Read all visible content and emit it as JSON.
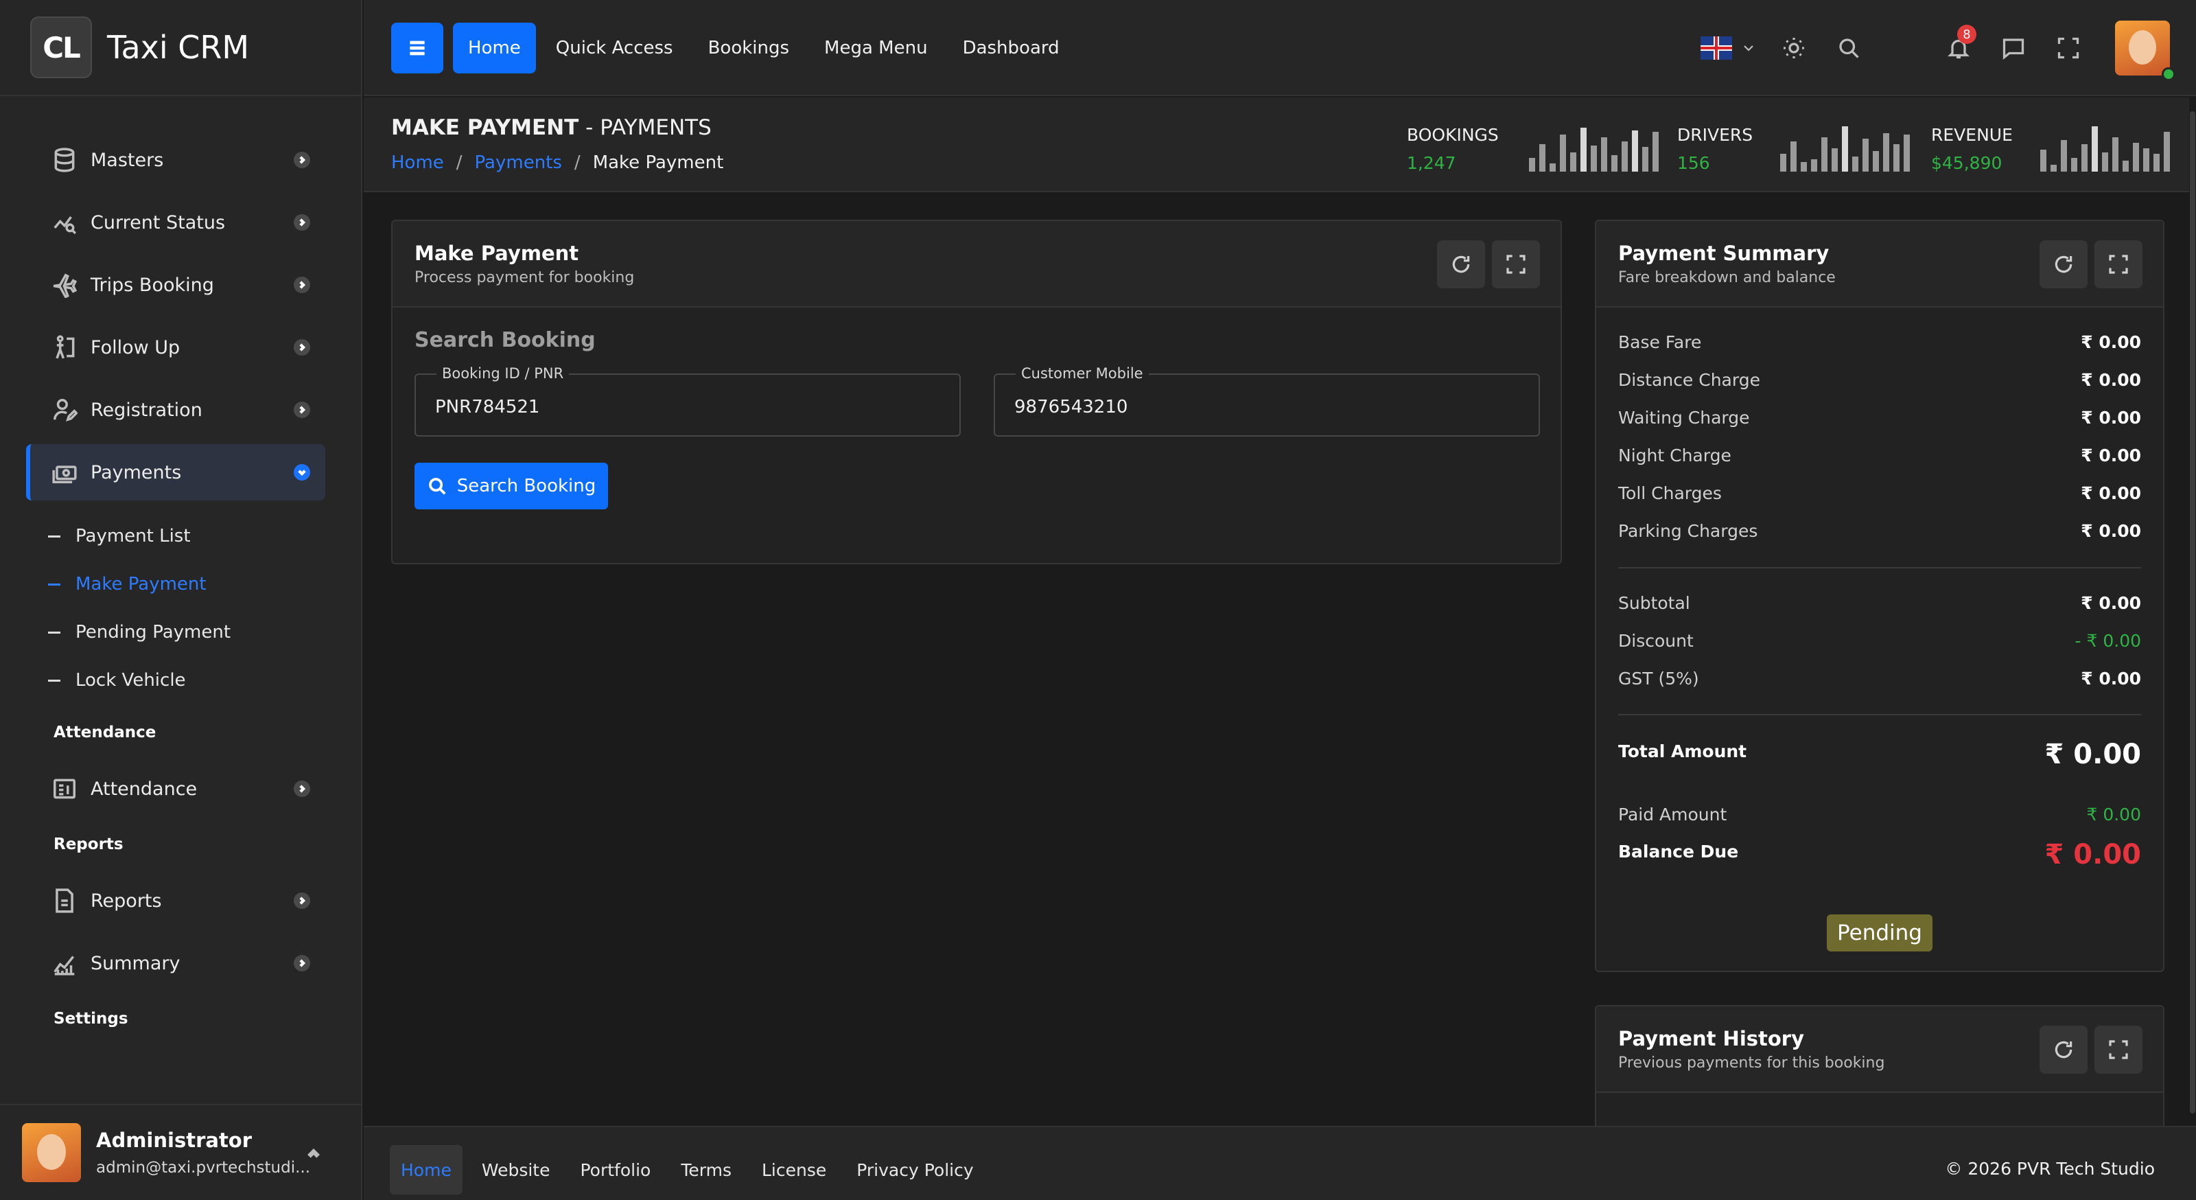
{
  "app": {
    "logo_text": "CL",
    "title": "Taxi CRM"
  },
  "sidebar": {
    "items": [
      {
        "label": "Masters",
        "icon": "database-icon"
      },
      {
        "label": "Current Status",
        "icon": "chart-search-icon"
      },
      {
        "label": "Trips Booking",
        "icon": "plane-icon"
      },
      {
        "label": "Follow Up",
        "icon": "walk-icon"
      },
      {
        "label": "Registration",
        "icon": "user-edit-icon"
      },
      {
        "label": "Payments",
        "icon": "cash-icon"
      }
    ],
    "payments_sub": [
      "Payment List",
      "Make Payment",
      "Pending Payment",
      "Lock Vehicle"
    ],
    "section_attendance": "Attendance",
    "attendance_item": "Attendance",
    "section_reports": "Reports",
    "reports_item": "Reports",
    "summary_item": "Summary",
    "section_settings": "Settings",
    "user": {
      "name": "Administrator",
      "email": "admin@taxi.pvrtechstudi..."
    }
  },
  "topbar": {
    "nav": [
      "Home",
      "Quick Access",
      "Bookings",
      "Mega Menu",
      "Dashboard"
    ],
    "notification_count": "8"
  },
  "page": {
    "title_bold": "MAKE PAYMENT",
    "title_rest": " - PAYMENTS",
    "breadcrumb": [
      "Home",
      "Payments",
      "Make Payment"
    ],
    "breadcrumb_sep": "/",
    "stats": [
      {
        "label": "BOOKINGS",
        "value": "1,247"
      },
      {
        "label": "DRIVERS",
        "value": "156"
      },
      {
        "label": "REVENUE",
        "value": "$45,890"
      }
    ]
  },
  "make_payment": {
    "title": "Make Payment",
    "subtitle": "Process payment for booking",
    "section": "Search Booking",
    "booking_label": "Booking ID / PNR",
    "booking_value": "PNR784521",
    "mobile_label": "Customer Mobile",
    "mobile_value": "9876543210",
    "search_button": "Search Booking"
  },
  "summary": {
    "title": "Payment Summary",
    "subtitle": "Fare breakdown and balance",
    "lines": [
      {
        "label": "Base Fare",
        "value": "₹ 0.00"
      },
      {
        "label": "Distance Charge",
        "value": "₹ 0.00"
      },
      {
        "label": "Waiting Charge",
        "value": "₹ 0.00"
      },
      {
        "label": "Night Charge",
        "value": "₹ 0.00"
      },
      {
        "label": "Toll Charges",
        "value": "₹ 0.00"
      },
      {
        "label": "Parking Charges",
        "value": "₹ 0.00"
      }
    ],
    "subtotal_label": "Subtotal",
    "subtotal_value": "₹ 0.00",
    "discount_label": "Discount",
    "discount_value": "- ₹ 0.00",
    "gst_label": "GST (5%)",
    "gst_value": "₹ 0.00",
    "total_label": "Total Amount",
    "total_value": "₹ 0.00",
    "paid_label": "Paid Amount",
    "paid_value": "₹ 0.00",
    "balance_label": "Balance Due",
    "balance_value": "₹ 0.00",
    "status": "Pending"
  },
  "history": {
    "title": "Payment History",
    "subtitle": "Previous payments for this booking"
  },
  "footer": {
    "links": [
      "Home",
      "Website",
      "Portfolio",
      "Terms",
      "License",
      "Privacy Policy"
    ],
    "copyright": "© 2026  PVR Tech Studio"
  },
  "colors": {
    "accent": "#0d6efd",
    "success": "#2fb344",
    "danger": "#e5343d",
    "pending": "#6f6a2d"
  }
}
